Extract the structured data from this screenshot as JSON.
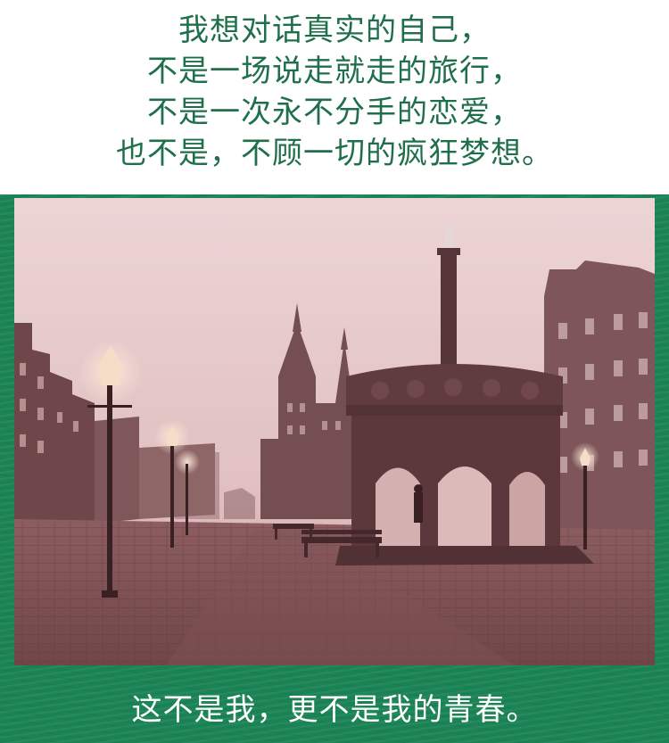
{
  "poem": {
    "lines": [
      "我想对话真实的自己，",
      "不是一场说走就走的旅行，",
      "不是一次永不分手的恋爱，",
      "也不是，不顾一切的疯狂梦想。"
    ]
  },
  "caption": "这不是我，更不是我的青春。",
  "colors": {
    "poem_text": "#1f6f4a",
    "panel_green": "#1c8657",
    "caption_text": "#ffffff",
    "photo_tint": "#d6b6b6"
  }
}
